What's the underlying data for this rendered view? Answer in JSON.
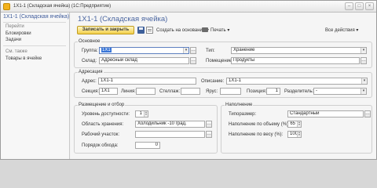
{
  "window": {
    "title": "1Х1-1 (Складская ячейка)  (1С:Предприятие)"
  },
  "sidebar": {
    "title": "1Х1-1 (Складская ячейка)",
    "go_section": "Перейти",
    "go_items": [
      "Блокировки",
      "Задачи"
    ],
    "see_also_section": "См. также",
    "see_also_items": [
      "Товары в ячейке"
    ]
  },
  "form": {
    "title": "1Х1-1 (Складская ячейка)",
    "toolbar": {
      "save_close": "Записать и закрыть",
      "create_based_on": "Создать на основании ▾",
      "print": "Печать ▾",
      "all_actions": "Все действия ▾"
    },
    "groups": {
      "main": "Основное",
      "addressing": "Адресация",
      "placement": "Размещение и отбор",
      "filling": "Наполнение"
    },
    "main": {
      "group_label": "Группа:",
      "group_value": "1Х1",
      "type_label": "Тип:",
      "type_value": "Хранение",
      "warehouse_label": "Склад:",
      "warehouse_value": "Адресный склад",
      "room_label": "Помещение:",
      "room_value": "Продукты"
    },
    "address": {
      "address_label": "Адрес:",
      "address_value": "1Х1-1",
      "description_label": "Описание:",
      "description_value": "1Х1-1",
      "section_label": "Секция:",
      "section_value": "1Х1",
      "line_label": "Линия:",
      "line_value": "",
      "rack_label": "Стеллаж:",
      "rack_value": "",
      "tier_label": "Ярус:",
      "tier_value": "",
      "position_label": "Позиция:",
      "position_value": "1",
      "separator_label": "Разделитель:",
      "separator_value": "-"
    },
    "placement": {
      "access_label": "Уровень доступности:",
      "access_value": "1",
      "storage_area_label": "Область хранения:",
      "storage_area_value": "Холодильник -10 град.",
      "work_area_label": "Рабочий участок:",
      "work_area_value": "",
      "bypass_label": "Порядок обхода:",
      "bypass_value": "0"
    },
    "filling": {
      "size_label": "Типоразмер:",
      "size_value": "Стандартный",
      "volume_label": "Наполнение по объему (%):",
      "volume_value": "65",
      "weight_label": "Наполнение по весу (%):",
      "weight_value": "100"
    }
  },
  "colors": {
    "accent": "#4c67a1",
    "primary_button": "#f2cf48",
    "selection": "#3875d7"
  }
}
